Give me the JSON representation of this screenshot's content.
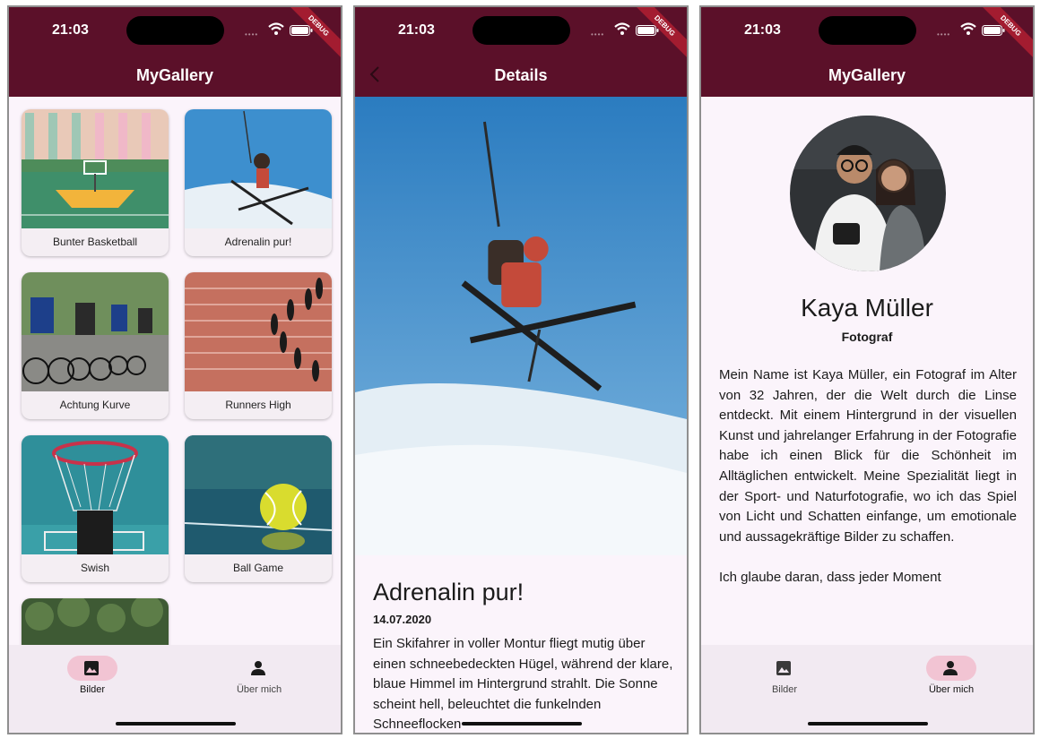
{
  "status": {
    "time": "21:03",
    "debug_label": "DEBUG"
  },
  "gallery": {
    "title": "MyGallery",
    "items": [
      {
        "label": "Bunter Basketball"
      },
      {
        "label": "Adrenalin pur!"
      },
      {
        "label": "Achtung Kurve"
      },
      {
        "label": "Runners High"
      },
      {
        "label": "Swish"
      },
      {
        "label": "Ball Game"
      }
    ]
  },
  "details": {
    "title": "Details",
    "heading": "Adrenalin pur!",
    "date": "14.07.2020",
    "description": "Ein Skifahrer in voller Montur fliegt mutig über einen schneebedeckten Hügel, während der klare, blaue Himmel im Hintergrund strahlt. Die Sonne scheint hell, beleuchtet die funkelnden Schneeflocken"
  },
  "profile": {
    "title": "MyGallery",
    "name": "Kaya Müller",
    "role": "Fotograf",
    "bio_1": "Mein Name ist Kaya Müller, ein Fotograf im Alter von 32 Jahren, der die Welt durch die Linse entdeckt. Mit einem Hintergrund in der visuellen Kunst und jahrelanger Erfahrung in der Fotografie habe ich einen Blick für die Schönheit im Alltäglichen entwickelt. Meine Spezialität liegt in der Sport- und Naturfotografie, wo ich das Spiel von Licht und Schatten einfange, um emotionale und aussagekräftige Bilder zu schaffen.",
    "bio_2": "Ich glaube daran, dass jeder Moment"
  },
  "nav": {
    "images_label": "Bilder",
    "about_label": "Über mich"
  },
  "colors": {
    "appbar": "#5b1029",
    "nav_active": "#f2c4d3",
    "background": "#fbf4fb"
  }
}
